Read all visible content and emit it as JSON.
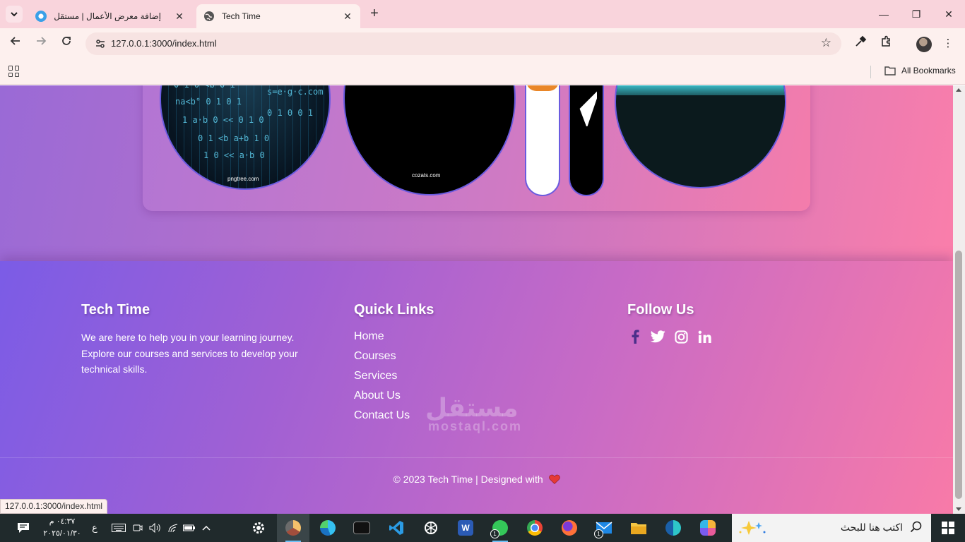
{
  "browser": {
    "tabs": [
      {
        "title": "إضافة معرض الأعمال | مستقل",
        "active": false
      },
      {
        "title": "Tech Time",
        "active": true
      }
    ],
    "url": "127.0.0.1:3000/index.html",
    "bookmarks_label": "All Bookmarks",
    "status_url": "127.0.0.1:3000/index.html"
  },
  "page": {
    "gallery": {
      "image_marks": [
        "pngtree.com",
        "cozats.com"
      ]
    },
    "footer": {
      "about": {
        "heading": "Tech Time",
        "text": "We are here to help you in your learning journey. Explore our courses and services to develop your technical skills."
      },
      "links": {
        "heading": "Quick Links",
        "items": [
          "Home",
          "Courses",
          "Services",
          "About Us",
          "Contact Us"
        ]
      },
      "follow": {
        "heading": "Follow Us",
        "icons": [
          "facebook-icon",
          "twitter-icon",
          "instagram-icon",
          "linkedin-icon"
        ]
      },
      "copyright": "© 2023 Tech Time | Designed with"
    },
    "watermark": {
      "arabic": "مستقل",
      "latin": "mostaql.com"
    }
  },
  "taskbar": {
    "time": "٠٤:٣٧ م",
    "date": "٢٠٢٥/٠١/٣٠",
    "lang": "ع",
    "search_placeholder": "اكتب هنا للبحث",
    "apps": [
      "settings-app",
      "chrome-dev-app",
      "edge-app",
      "terminal-app",
      "vscode-app",
      "chatgpt-app",
      "word-app",
      "whatsapp-app",
      "chrome-app",
      "firefox-app",
      "mail-app",
      "file-explorer-app",
      "edge-beta-app",
      "copilot-app"
    ],
    "badge_count": "1"
  },
  "colors": {
    "footer_start": "#7b5ce6",
    "footer_end": "#f87aa8",
    "heart": "#e53935",
    "oval_border": "#6a5bdf"
  }
}
